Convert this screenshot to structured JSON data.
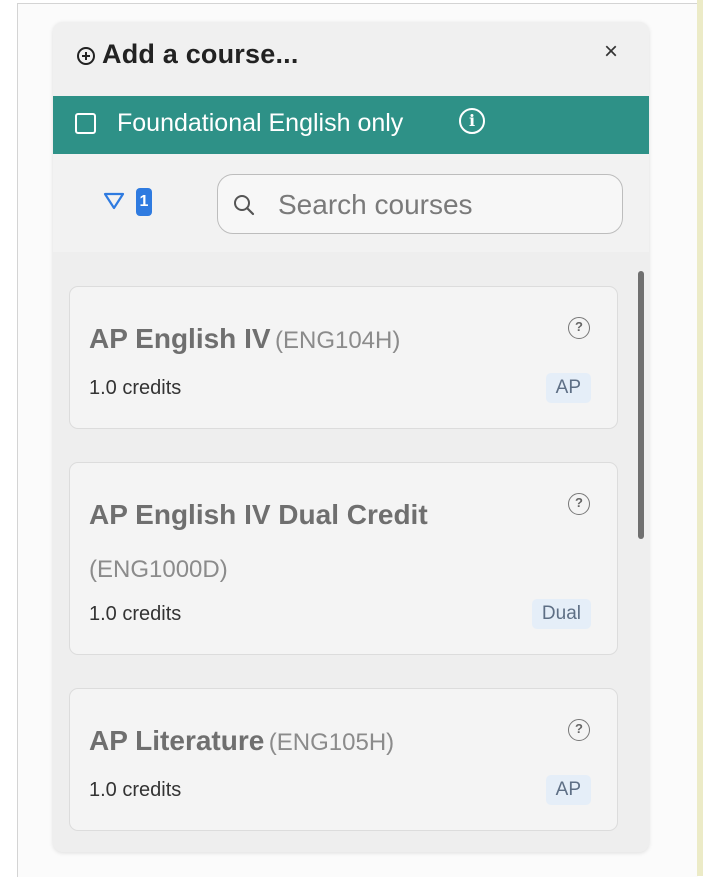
{
  "header": {
    "title": "Add a course...",
    "close_label": "×"
  },
  "filter_banner": {
    "label": "Foundational English only",
    "info_label": "i"
  },
  "toolbar": {
    "filter_count": "1",
    "search_placeholder": "Search courses"
  },
  "courses": [
    {
      "name": "AP English IV",
      "code": "(ENG104H)",
      "credits": "1.0 credits",
      "tag": "AP",
      "help": "?"
    },
    {
      "name": "AP English IV Dual Credit",
      "code": "(ENG1000D)",
      "credits": "1.0 credits",
      "tag": "Dual",
      "help": "?"
    },
    {
      "name": "AP Literature",
      "code": "(ENG105H)",
      "credits": "1.0 credits",
      "tag": "AP",
      "help": "?"
    }
  ],
  "colors": {
    "banner": "#2e9187",
    "filter_badge": "#2f7be0",
    "tag_bg": "#e5eef8"
  }
}
